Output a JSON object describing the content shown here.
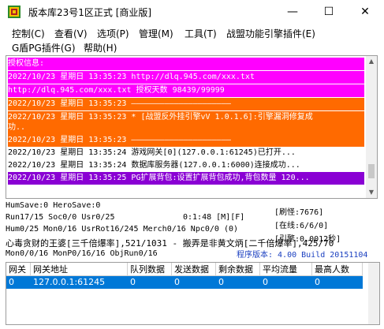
{
  "window": {
    "title": "版本库23号1区正式 [商业版]",
    "minimize_glyph": "—",
    "maximize_glyph": "☐",
    "close_glyph": "✕"
  },
  "menu": {
    "items": [
      "控制(C)",
      "查看(V)",
      "选项(P)",
      "管理(M)",
      "工具(T)",
      "战盟功能引擎插件(E)",
      "G盾PG插件(G)",
      "帮助(H)"
    ]
  },
  "log": {
    "lines": [
      {
        "text": "授权信息:",
        "bg": "#ff00ff",
        "fg": "#ffffff"
      },
      {
        "text": "2022/10/23 星期日 13:35:23 http://dlq.945.com/xxx.txt",
        "bg": "#ff00ff",
        "fg": "#ffffff"
      },
      {
        "text": "http://dlq.945.com/xxx.txt 授权天数 98439/99999",
        "bg": "#ff00ff",
        "fg": "#ffffff"
      },
      {
        "text": "2022/10/23 星期日 13:35:23 —————————————————————",
        "bg": "#ff6a00",
        "fg": "#ffffff"
      },
      {
        "text": "2022/10/23 星期日 13:35:23 * [战盟反外挂引擎vV 1.0.1.6]:引擎漏洞修复成",
        "bg": "#ff6a00",
        "fg": "#ffffff"
      },
      {
        "text": "功..",
        "bg": "#ff6a00",
        "fg": "#ffffff"
      },
      {
        "text": "2022/10/23 星期日 13:35:23 —————————————————————",
        "bg": "#ff6a00",
        "fg": "#ffffff"
      },
      {
        "text": "2022/10/23 星期日 13:35:24 游戏网关[0](127.0.0.1:61245)已打开...",
        "bg": "#ffffff",
        "fg": "#000000"
      },
      {
        "text": "2022/10/23 星期日 13:35:24 数据库服务器(127.0.0.1:6000)连接成功...",
        "bg": "#ffffff",
        "fg": "#000000"
      },
      {
        "text": "2022/10/23 星期日 13:35:25 PG扩展背包:设置扩展背包成功,背包数量 120...",
        "bg": "#8a00d4",
        "fg": "#ffffff"
      }
    ]
  },
  "status": {
    "line1": "HumSave:0 HeroSave:0",
    "line2": "Run17/15 Soc0/0 Usr0/25",
    "line2_time": "0:1:48 [M][F]",
    "line3": "Hum0/25 Mon0/16 UsrRot16/245 Merch0/16 Npc0/0 (0)",
    "line4": "心毒贪财的王婆[三千倍爆率],521/1031 - 搬弄是非黄文炳[二千倍爆率],425/70",
    "line5": "Mon0/0/16 MonP0/16/16 ObjRun0/16",
    "refresh": "[刷怪:7676]",
    "online": "[在线:6/6/0]",
    "engine": "[引擎:0.0012秒]",
    "version": "程序版本: 4.00 Build 20151104",
    "version_color": "#1a3fc0"
  },
  "gateway_table": {
    "columns": [
      "网关",
      "网关地址",
      "队列数据",
      "发送数据",
      "剩余数据",
      "平均流量",
      "最高人数"
    ],
    "rows": [
      [
        "0",
        "127.0.0.1:61245",
        "0",
        "0",
        "0",
        "0",
        "0"
      ]
    ]
  }
}
